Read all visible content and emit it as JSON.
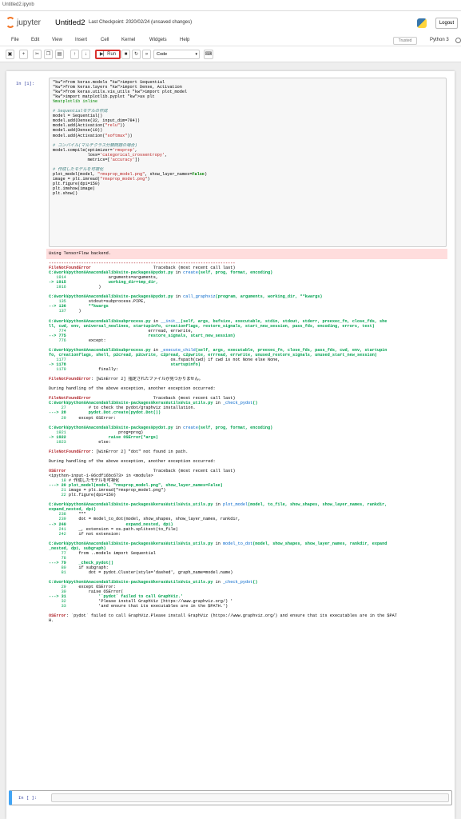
{
  "browser_tab": "Untitled2.ipynb",
  "header": {
    "logo_text": "jupyter",
    "notebook_title": "Untitled2",
    "checkpoint": "Last Checkpoint: 2020/02/24   (unsaved changes)",
    "logout_label": "Logout"
  },
  "menu": {
    "items": [
      "File",
      "Edit",
      "View",
      "Insert",
      "Cell",
      "Kernel",
      "Widgets",
      "Help"
    ],
    "trusted_label": "Trusted",
    "kernel_name": "Python 3"
  },
  "toolbar": {
    "save_icon": "save-icon",
    "add_icon": "plus-icon",
    "cut_icon": "scissors-icon",
    "copy_icon": "copy-icon",
    "paste_icon": "paste-icon",
    "up_icon": "arrow-up-icon",
    "down_icon": "arrow-down-icon",
    "run_label": "Run",
    "interrupt_icon": "stop-icon",
    "restart_icon": "restart-icon",
    "restart_run_icon": "fast-forward-icon",
    "cell_type": "Code",
    "keyboard_icon": "keyboard-icon",
    "run_highlight_color": "#d9302c"
  },
  "cell1": {
    "prompt": "In [1]:",
    "code_lines": [
      "from keras.models import Sequential",
      "from keras.layers import Dense, Activation",
      "from keras.utils.vis_utils import plot_model",
      "import matplotlib.pyplot as plt",
      "%matplotlib inline",
      "",
      "# Sequentialモデルの作成",
      "model = Sequential()",
      "model.add(Dense(32, input_dim=784))",
      "model.add(Activation(\"relu\"))",
      "model.add(Dense(10))",
      "model.add(Activation(\"softmax\"))",
      "",
      "# コンパイル(マルチクラス分類問題の場合)",
      "model.compile(optimizer='rmsprop',",
      "              loss='categorical_crossentropy',",
      "              metrics=['accuracy'])",
      "",
      "# 作成したモデルを可視化",
      "plot_model(model, \"rmsprop_model.png\", show_layer_names=False)",
      "image = plt.imread(\"rmsprop_model.png\")",
      "plt.figure(dpi=150)",
      "plt.imshow(image)",
      "plt.show()"
    ],
    "stderr": "Using TensorFlow backend.",
    "traceback_lines": [
      "---------------------------------------------------------------------------",
      "FileNotFoundError                         Traceback (most recent call last)",
      "C:¥work¥python¥Anaconda¥lib¥site-packages¥pydot.py in create(self, prog, format, encoding)",
      "   1914                 arguments=arguments,",
      "-> 1915                 working_dir=tmp_dir,",
      "   1916             )",
      "",
      "C:¥work¥python¥Anaconda¥lib¥site-packages¥pydot.py in call_graphviz(program, arguments, working_dir, **kwargs)",
      "    135         stdout=subprocess.PIPE,",
      "--> 136         **kwargs",
      "    137     )",
      "",
      "C:¥work¥python¥Anaconda¥lib¥subprocess.py in __init__(self, args, bufsize, executable, stdin, stdout, stderr, preexec_fn, close_fds, she",
      "ll, cwd, env, universal_newlines, startupinfo, creationflags, restore_signals, start_new_session, pass_fds, encoding, errors, text)",
      "    774                                 errread, errwrite,",
      "--> 775                                 restore_signals, start_new_session)",
      "    776         except:",
      "",
      "C:¥work¥python¥Anaconda¥lib¥subprocess.py in _execute_child(self, args, executable, preexec_fn, close_fds, pass_fds, cwd, env, startupin",
      "fo, creationflags, shell, p2cread, p2cwrite, c2pread, c2pwrite, errread, errwrite, unused_restore_signals, unused_start_new_session)",
      "   1177                                          os.fspath(cwd) if cwd is not None else None,",
      "-> 1178                                          startupinfo)",
      "   1179             finally:",
      "",
      "FileNotFoundError: [WinError 2] 指定されたファイルが見つかりません。",
      "",
      "During handling of the above exception, another exception occurred:",
      "",
      "FileNotFoundError                         Traceback (most recent call last)",
      "C:¥work¥python¥Anaconda¥lib¥site-packages¥keras¥utils¥vis_utils.py in _check_pydot()",
      "     27         # to check the pydot/graphviz installation.",
      "---> 28         pydot.Dot.create(pydot.Dot())",
      "     29     except OSError:",
      "",
      "C:¥work¥python¥Anaconda¥lib¥site-packages¥pydot.py in create(self, prog, format, encoding)",
      "   1921                     prog=prog)",
      "-> 1922                 raise OSError(*args)",
      "   1923             else:",
      "",
      "FileNotFoundError: [WinError 2] \"dot\" not found in path.",
      "",
      "During handling of the above exception, another exception occurred:",
      "",
      "OSError                                   Traceback (most recent call last)",
      "<ipython-input-1-06cdf16bc673> in <module>",
      "     18 # 作成したモデルを可視化",
      "---> 20 plot_model(model, \"rmsprop_model.png\", show_layer_names=False)",
      "     21 image = plt.imread(\"rmsprop_model.png\")",
      "     22 plt.figure(dpi=150)",
      "",
      "C:¥work¥python¥Anaconda¥lib¥site-packages¥keras¥utils¥vis_utils.py in plot_model(model, to_file, show_shapes, show_layer_names, rankdir,",
      "expand_nested, dpi)",
      "    238     \"\"\"",
      "    239     dot = model_to_dot(model, show_shapes, show_layer_names, rankdir,",
      "--> 240                        expand_nested, dpi)",
      "    241     _, extension = os.path.splitext(to_file)",
      "    242     if not extension:",
      "",
      "C:¥work¥python¥Anaconda¥lib¥site-packages¥keras¥utils¥vis_utils.py in model_to_dot(model, show_shapes, show_layer_names, rankdir, expand",
      "_nested, dpi, subgraph)",
      "     77     from ..models import Sequential",
      "     78",
      "---> 79     _check_pydot()",
      "     80     if subgraph:",
      "     81         dot = pydot.Cluster(style='dashed', graph_name=model.name)",
      "",
      "C:¥work¥python¥Anaconda¥lib¥site-packages¥keras¥utils¥vis_utils.py in _check_pydot()",
      "     29     except OSError:",
      "     30         raise OSError(",
      "---> 31             '`pydot` failed to call GraphViz.'",
      "     32             'Please install GraphViz (https://www.graphviz.org/) '",
      "     33             'and ensure that its executables are in the $PATH.')",
      "",
      "OSError: `pydot` failed to call GraphViz.Please install GraphViz (https://www.graphviz.org/) and ensure that its executables are in the $PAT",
      "H."
    ]
  },
  "cell2": {
    "prompt": "In [ ]:"
  }
}
